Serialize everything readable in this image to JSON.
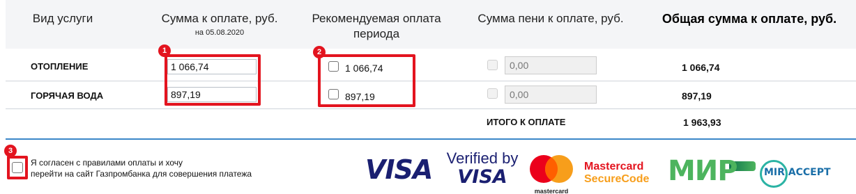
{
  "headers": {
    "service": "Вид услуги",
    "amount": "Сумма к оплате, руб.",
    "amount_date": "на 05.08.2020",
    "recommended_line1": "Рекомендуемая оплата",
    "recommended_line2": "периода",
    "peni": "Сумма пени к оплате, руб.",
    "total": "Общая сумма к оплате, руб."
  },
  "rows": [
    {
      "service": "ОТОПЛЕНИЕ",
      "amount": "1 066,74",
      "recommended": "1 066,74",
      "peni": "0,00",
      "total": "1 066,74"
    },
    {
      "service": "ГОРЯЧАЯ ВОДА",
      "amount": "897,19",
      "recommended": "897,19",
      "peni": "0,00",
      "total": "897,19"
    }
  ],
  "summary": {
    "label": "ИТОГО К ОПЛАТЕ",
    "value": "1 963,93"
  },
  "markers": [
    "1",
    "2",
    "3"
  ],
  "agreement": {
    "line1": "Я согласен с правилами оплаты и хочу",
    "line2": "перейти на сайт Газпромбанка для совершения платежа"
  },
  "logos": {
    "visa": "VISA",
    "verified_line1": "Verified by",
    "verified_line2": "VISA",
    "mastercard_caption": "mastercard",
    "securecode_line1": "Mastercard",
    "securecode_line2": "SecureCode",
    "mir": "МИР",
    "mir_accept": "MIR ACCEPT"
  },
  "colors": {
    "highlight_red": "#e3141f",
    "divider_blue": "#3a86c8",
    "visa_blue": "#1a1f71",
    "mc_red": "#eb001b",
    "mc_orange": "#f79e1b",
    "mir_green": "#4db45e",
    "mir_blue": "#0f754e"
  }
}
